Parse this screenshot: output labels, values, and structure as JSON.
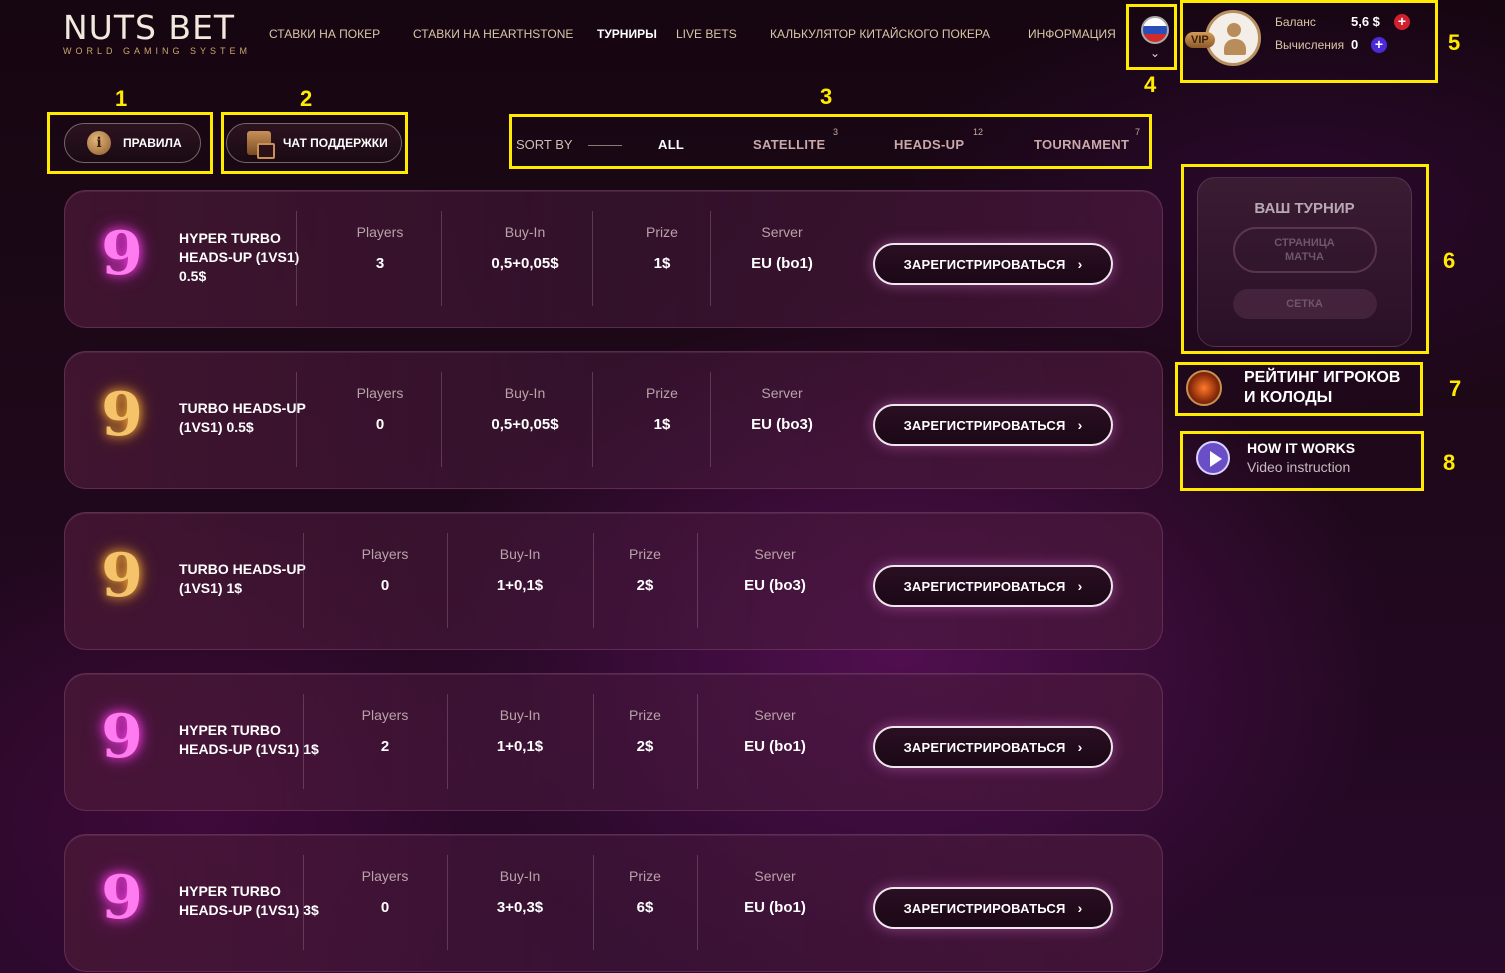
{
  "logo": {
    "main": "NUTS BET",
    "sub": "WORLD GAMING SYSTEM"
  },
  "nav": [
    {
      "label": "СТАВКИ НА ПОКЕР",
      "active": false
    },
    {
      "label": "СТАВКИ НА HEARTHSTONE",
      "active": false
    },
    {
      "label": "ТУРНИРЫ",
      "active": true
    },
    {
      "label": "LIVE BETS",
      "active": false
    },
    {
      "label": "КАЛЬКУЛЯТОР КИТАЙСКОГО ПОКЕРА",
      "active": false
    },
    {
      "label": "ИНФОРМАЦИЯ",
      "active": false
    }
  ],
  "language": {
    "chevron": "⌄"
  },
  "account": {
    "vip_label": "VIP",
    "balance_label": "Баланс",
    "balance_value": "5,6 $",
    "calc_label": "Вычисления",
    "calc_value": "0"
  },
  "buttons": {
    "rules": "ПРАВИЛА",
    "support": "ЧАТ ПОДДЕРЖКИ"
  },
  "sort": {
    "label": "SORT BY",
    "items": [
      {
        "label": "ALL",
        "count": "",
        "active": true
      },
      {
        "label": "SATELLITE",
        "count": "3",
        "active": false
      },
      {
        "label": "HEADS-UP",
        "count": "12",
        "active": false
      },
      {
        "label": "TOURNAMENT",
        "count": "7",
        "active": false
      }
    ]
  },
  "columns": {
    "players": "Players",
    "buyin": "Buy-In",
    "prize": "Prize",
    "server": "Server"
  },
  "register_label": "ЗАРЕГИСТРИРОВАТЬСЯ",
  "tournaments": [
    {
      "title_lines": [
        "HYPER TURBO",
        "HEADS-UP (1VS1)",
        "0.5$"
      ],
      "emblem": "pink",
      "players": "3",
      "buyin": "0,5+0,05$",
      "prize": "1$",
      "server": "EU (bo1)"
    },
    {
      "title_lines": [
        "TURBO HEADS-UP",
        "(1VS1) 0.5$"
      ],
      "emblem": "gold",
      "players": "0",
      "buyin": "0,5+0,05$",
      "prize": "1$",
      "server": "EU (bo3)"
    },
    {
      "title_lines": [
        "TURBO HEADS-UP",
        "(1VS1) 1$"
      ],
      "emblem": "gold",
      "players": "0",
      "buyin": "1+0,1$",
      "prize": "2$",
      "server": "EU (bo3)"
    },
    {
      "title_lines": [
        "HYPER TURBO",
        "HEADS-UP (1VS1) 1$"
      ],
      "emblem": "pink",
      "players": "2",
      "buyin": "1+0,1$",
      "prize": "2$",
      "server": "EU (bo1)"
    },
    {
      "title_lines": [
        "HYPER TURBO",
        "HEADS-UP (1VS1) 3$"
      ],
      "emblem": "pink",
      "players": "0",
      "buyin": "3+0,3$",
      "prize": "6$",
      "server": "EU (bo1)"
    }
  ],
  "your_tournament": {
    "title": "ВАШ ТУРНИР",
    "match_page": "СТРАНИЦА МАТЧА",
    "bracket": "СЕТКА"
  },
  "rating": {
    "line1": "РЕЙТИНГ ИГРОКОВ",
    "line2": "И КОЛОДЫ"
  },
  "how_it_works": {
    "title": "HOW IT WORKS",
    "subtitle": "Video instruction"
  },
  "annotations": [
    "1",
    "2",
    "3",
    "4",
    "5",
    "6",
    "7",
    "8"
  ],
  "colors": {
    "annotation": "#ffeb00",
    "background": "#1d0818",
    "pink_glow": "#ff3ee0",
    "gold_glow": "#ffb040"
  }
}
